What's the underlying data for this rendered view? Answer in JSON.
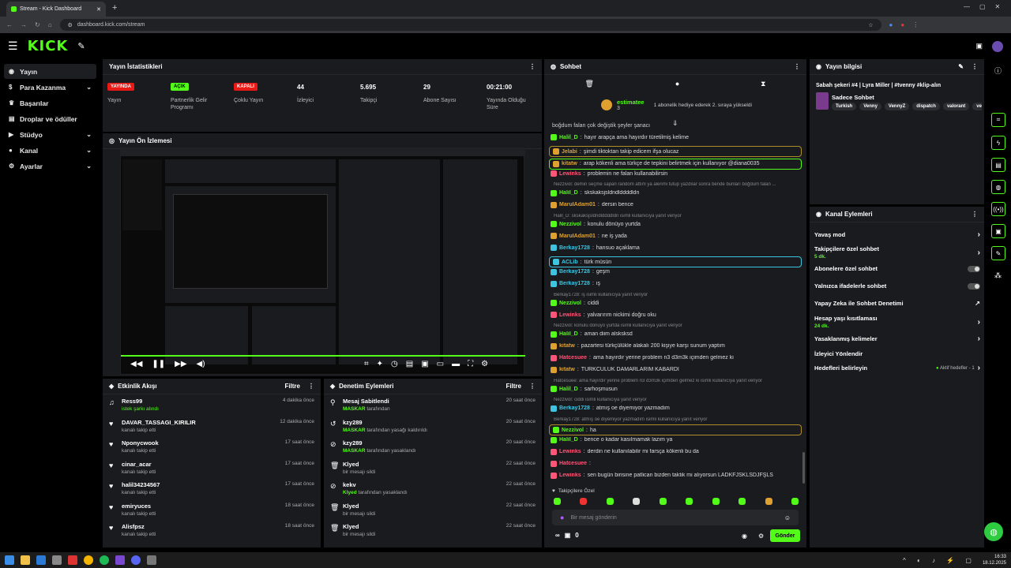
{
  "browser": {
    "tab_title": "Stream - Kick Dashboard",
    "url": "dashboard.kick.com/stream"
  },
  "brand": {
    "logo": "KICK",
    "accent": "#53fc18"
  },
  "sidebar": {
    "items": [
      {
        "label": "Yayın",
        "icon": "signal-icon"
      },
      {
        "label": "Para Kazanma",
        "icon": "money-icon"
      },
      {
        "label": "Başarılar",
        "icon": "trophy-icon"
      },
      {
        "label": "Droplar ve ödüller",
        "icon": "gift-icon"
      },
      {
        "label": "Stüdyo",
        "icon": "camera-icon"
      },
      {
        "label": "Kanal",
        "icon": "user-icon"
      },
      {
        "label": "Ayarlar",
        "icon": "gear-icon"
      }
    ]
  },
  "stats": {
    "title": "Yayın İstatistikleri",
    "items": [
      {
        "value": "YAYINDA",
        "label": "Yayın"
      },
      {
        "value": "AÇIK",
        "label": "Partnerlik Gelir Programı"
      },
      {
        "value": "KAPALI",
        "label": "Çoklu Yayın"
      },
      {
        "value": "44",
        "label": "İzleyici"
      },
      {
        "value": "5.695",
        "label": "Takipçi"
      },
      {
        "value": "29",
        "label": "Abone Sayısı"
      },
      {
        "value": "00:21:00",
        "label": "Yayında Olduğu Süre"
      }
    ]
  },
  "preview": {
    "title": "Yayın Ön İzlemesi"
  },
  "activity": {
    "title": "Etkinlik Akışı",
    "filter": "Filtre",
    "items": [
      {
        "name": "Ress99",
        "sub": "istek şarkı alındı",
        "time": "4 dakika önce",
        "icon": "music-icon"
      },
      {
        "name": "DAVAR_TASSAGI_KIRILIR",
        "sub": "kanalı takip etti",
        "time": "12 dakika önce",
        "icon": "heart-icon"
      },
      {
        "name": "Nponycwook",
        "sub": "kanalı takip etti",
        "time": "17 saat önce",
        "icon": "heart-icon"
      },
      {
        "name": "cinar_acar",
        "sub": "kanalı takip etti",
        "time": "17 saat önce",
        "icon": "heart-icon"
      },
      {
        "name": "halil34234567",
        "sub": "kanalı takip etti",
        "time": "17 saat önce",
        "icon": "heart-icon"
      },
      {
        "name": "emiryuces",
        "sub": "kanalı takip etti",
        "time": "18 saat önce",
        "icon": "heart-icon"
      },
      {
        "name": "Alisfpsz",
        "sub": "kanalı takip etti",
        "time": "18 saat önce",
        "icon": "heart-icon"
      }
    ]
  },
  "moderation": {
    "title": "Denetim Eylemleri",
    "filter": "Filtre",
    "items": [
      {
        "name": "Mesaj Sabitlendi",
        "by": "MASKAR",
        "sub": " tarafından",
        "time": "20 saat önce",
        "icon": "pin-icon"
      },
      {
        "name": "kzy289",
        "by": "MASKAR",
        "sub": " tarafından yasağı kaldırıldı",
        "time": "20 saat önce",
        "icon": "undo-icon"
      },
      {
        "name": "kzy289",
        "by": "MASKAR",
        "sub": " tarafından yasaklandı",
        "time": "20 saat önce",
        "icon": "ban-icon"
      },
      {
        "name": "Klyed",
        "by": "",
        "sub": "bir mesajı sildi",
        "time": "22 saat önce",
        "icon": "trash-icon"
      },
      {
        "name": "kekv",
        "by": "Klyed",
        "sub": " tarafından yasaklandı",
        "time": "22 saat önce",
        "icon": "ban-icon"
      },
      {
        "name": "Klyed",
        "by": "",
        "sub": "bir mesajı sildi",
        "time": "22 saat önce",
        "icon": "trash-icon"
      },
      {
        "name": "Klyed",
        "by": "",
        "sub": "bir mesajı sildi",
        "time": "22 saat önce",
        "icon": "trash-icon"
      }
    ]
  },
  "chat": {
    "title": "Sohbet",
    "top_user": "estimatee",
    "top_count": "3",
    "top_note": "1 abonelik hediye ederek 2. sıraya yükseldi",
    "first_line": "boğdum falan çok değiştik şeyler şanacı",
    "messages": [
      {
        "user": "Halil_D",
        "color": "#53fc18",
        "text": "hayır arapça ama hayırdır türetilmiş kelime",
        "style": ""
      },
      {
        "user": "Jelabi",
        "color": "#e0a030",
        "text": "şimdi tiktoktan takip edicem ifşa olucaz",
        "style": "box"
      },
      {
        "user": "kitatw",
        "color": "#e0a030",
        "text": "arap kökenli ama türkçe de tepkini belirtmek için kullanıyor @diana0035",
        "style": "box g"
      },
      {
        "user": "Lewinks",
        "color": "#ff5577",
        "text": "problemin ne falan kullanabilirsin",
        "style": ""
      },
      {
        "reply": "Nezzivol: demin seçme sapan random attım ya alerimi tutup yazdılar sonra bende bunları boğdum falan ..."
      },
      {
        "user": "Halil_D",
        "color": "#53fc18",
        "text": "skskaksjsldndlddddldn",
        "style": ""
      },
      {
        "user": "MaruIAdam01",
        "color": "#e0a030",
        "text": "dersin bence",
        "style": ""
      },
      {
        "reply": "Halil_D: skskaksjsldndlddddldn isimli kullanıcıya yanıt veriyor"
      },
      {
        "user": "Nezzivol",
        "color": "#53fc18",
        "text": "konulu dönüyo yurtda",
        "style": ""
      },
      {
        "user": "MaruIAdam01",
        "color": "#e0a030",
        "text": "ne iş yada",
        "style": ""
      },
      {
        "user": "Berkay1728",
        "color": "#3cc4e0",
        "text": "hansuo açaklama",
        "style": ""
      },
      {
        "user": "ACLib",
        "color": "#3cc4e0",
        "text": "türk müsün",
        "style": "box b"
      },
      {
        "user": "Berkay1728",
        "color": "#3cc4e0",
        "text": "geşm",
        "style": ""
      },
      {
        "user": "Berkay1728",
        "color": "#3cc4e0",
        "text": "iş",
        "style": ""
      },
      {
        "reply": "Berkay1728: iş isimli kullanıcıya yanıt veriyor"
      },
      {
        "user": "Nezzivol",
        "color": "#53fc18",
        "text": "ciddi",
        "style": ""
      },
      {
        "user": "Lewinks",
        "color": "#ff5577",
        "text": "yalvarırım nickimi doğru oku",
        "style": ""
      },
      {
        "reply": "Nezzivol: konulu dönüyo yurtda isimli kullanıcıya yanıt veriyor"
      },
      {
        "user": "Halil_D",
        "color": "#53fc18",
        "text": "aman diim alsksksd",
        "style": ""
      },
      {
        "user": "kitatw",
        "color": "#e0a030",
        "text": "pazartesi türkçülükle alakalı 200 kişiye karşı sunum yaptım",
        "style": ""
      },
      {
        "user": "Hatcesuee",
        "color": "#ff5577",
        "text": "ama hayırdır yerine problem n3 d3m3k içimden gelmez ki",
        "style": ""
      },
      {
        "user": "kitatw",
        "color": "#e0a030",
        "text": "TÜRKCÜLÜK DAMARLARIM KABARDI",
        "style": ""
      },
      {
        "reply": "Hatcesuee: ama hayırdır yerine problem n3 d3m3k içimden gelmez ki isimli kullanıcıya yanıt veriyor"
      },
      {
        "user": "Halil_D",
        "color": "#53fc18",
        "text": "sarhoşmusun",
        "style": ""
      },
      {
        "reply": "Nezzivol: ciddi isimli kullanıcıya yanıt veriyor"
      },
      {
        "user": "Berkay1728",
        "color": "#3cc4e0",
        "text": "atmış oe diyemiyor yazmadım",
        "style": ""
      },
      {
        "reply": "Berkay1728: atmış oe diyemiyor yazmadım isimli kullanıcıya yanıt veriyor"
      },
      {
        "user": "Nezzivol",
        "color": "#53fc18",
        "text": "ha",
        "style": "box"
      },
      {
        "user": "Halil_D",
        "color": "#53fc18",
        "text": "bence o kadar kasılmamak lazım ya",
        "style": ""
      },
      {
        "user": "Lewinks",
        "color": "#ff5577",
        "text": "derdin ne kullanılabilir mi farsça kökenli bu da",
        "style": ""
      },
      {
        "user": "Hatcesuee",
        "color": "#ff5577",
        "text": "",
        "style": ""
      },
      {
        "user": "Lewinks",
        "color": "#ff5577",
        "text": "sen bugün birisine patlican bizden taktik mi alıyorsun LADKFJSKLSDJFŞLS",
        "style": ""
      }
    ],
    "followers_only": "Takipçilere Özel",
    "input_placeholder": "Bir mesaj gönderin",
    "send": "Gönder",
    "counter": "0"
  },
  "stream_info": {
    "title": "Yayın bilgisi",
    "stream_title": "Sabah şekeri #4 | Lyra Miller | #tvenny #klip-alın",
    "category": "Sadece Sohbet",
    "tags": [
      "Turkish",
      "Venny",
      "VennyZ",
      "dispatch",
      "valorant",
      "ven"
    ]
  },
  "channel_actions": {
    "title": "Kanal Eylemleri",
    "items": [
      {
        "label": "Yavaş mod",
        "sub": "",
        "ctl": "arrow"
      },
      {
        "label": "Takipçilere özel sohbet",
        "sub": "5 dk.",
        "ctl": "arrow"
      },
      {
        "label": "Abonelere özel sohbet",
        "sub": "",
        "ctl": "toggle"
      },
      {
        "label": "Yalnızca ifadelerle sohbet",
        "sub": "",
        "ctl": "toggle"
      },
      {
        "label": "Yapay Zeka ile Sohbet Denetimi",
        "sub": "",
        "ctl": "ext"
      },
      {
        "label": "Hesap yaşı kısıtlaması",
        "sub": "24 dk.",
        "ctl": "arrow"
      },
      {
        "label": "Yasaklanmış kelimeler",
        "sub": "",
        "ctl": "arrow"
      },
      {
        "label": "İzleyici Yönlendir",
        "sub": "",
        "ctl": ""
      },
      {
        "label": "Hedefleri belirleyin",
        "sub": "",
        "ctl": "goal"
      }
    ],
    "goal_text": "Aktif hedefler - 1"
  },
  "taskbar": {
    "time": "16:33",
    "date": "18.12.2025"
  }
}
